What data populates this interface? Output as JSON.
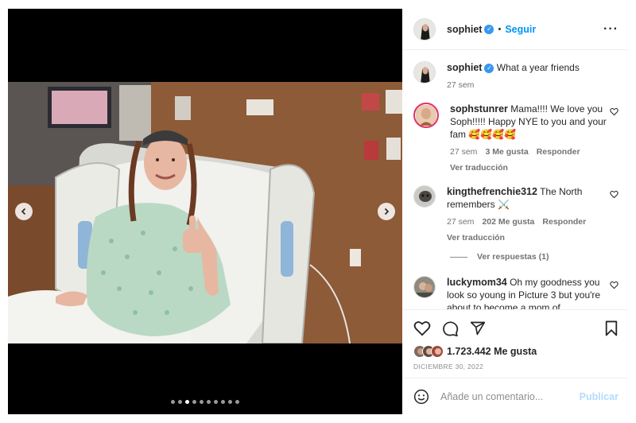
{
  "post": {
    "username": "sophiet",
    "follow_label": "Seguir",
    "caption": "What a year friends",
    "caption_time": "27 sem",
    "likes": "1.723.442 Me gusta",
    "date": "DICIEMBRE 30, 2022"
  },
  "comments": [
    {
      "username": "sophstunrer",
      "text": "Mama!!!! We love you Soph!!!!! Happy NYE to you and your fam 🥰🥰🥰🥰",
      "time": "27 sem",
      "likes": "3 Me gusta",
      "reply": "Responder",
      "translate": "Ver traducción"
    },
    {
      "username": "kingthefrenchie312",
      "text": "The North remembers ⚔️",
      "time": "27 sem",
      "likes": "202 Me gusta",
      "reply": "Responder",
      "translate": "Ver traducción",
      "replies": "Ver respuestas (1)"
    },
    {
      "username": "luckymom34",
      "text": "Oh my goodness you look so young in Picture 3 but you're about to become a mom of"
    }
  ],
  "composer": {
    "placeholder": "Añade un comentario...",
    "publish_label": "Publicar"
  },
  "carousel": {
    "slide_count": 10,
    "active_index": 2
  },
  "colors": {
    "accent": "#0095f6",
    "verified": "#3897f0"
  },
  "icons": [
    "more-icon",
    "heart-icon",
    "comment-icon",
    "share-icon",
    "bookmark-icon",
    "emoji-icon",
    "chevron-left-icon",
    "chevron-right-icon"
  ]
}
